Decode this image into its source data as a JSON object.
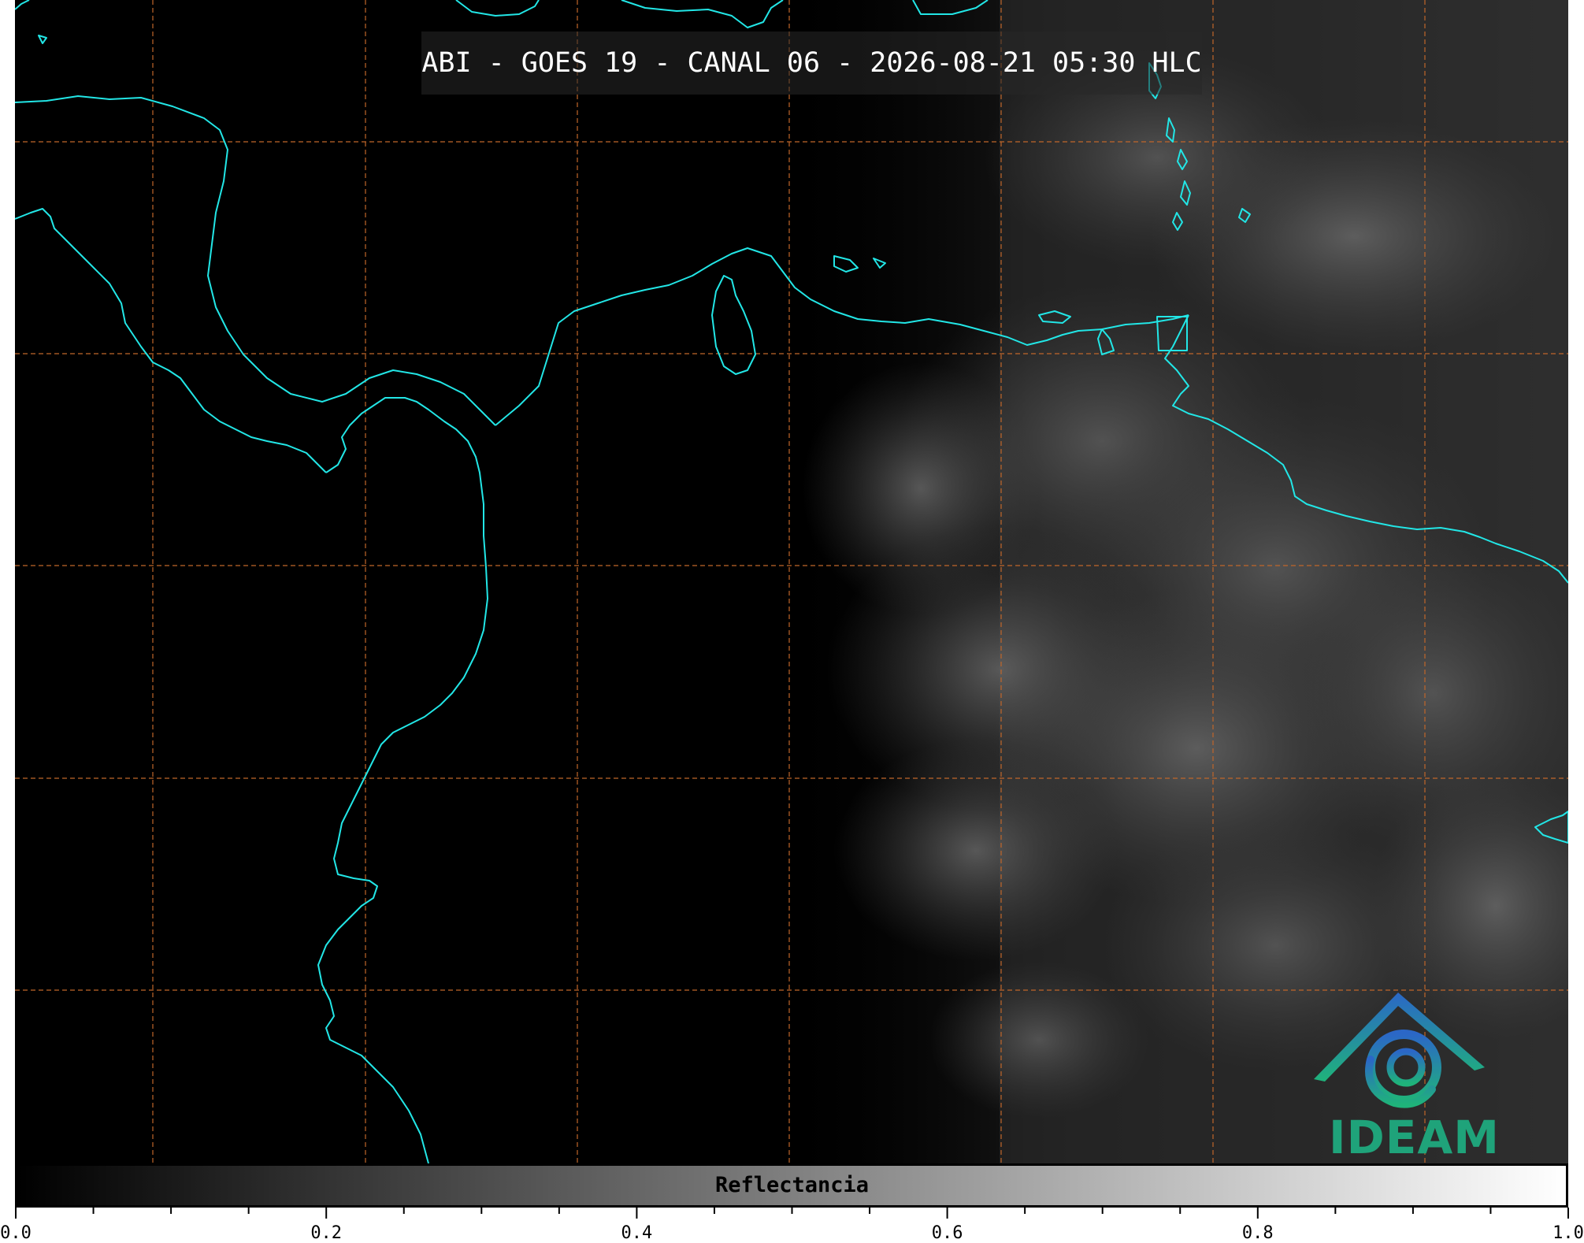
{
  "title": "ABI - GOES 19 - CANAL 06 - 2026-08-21 05:30 HLC",
  "map": {
    "coastline_color": "#22e6e6",
    "gridline_color": "#c0662a",
    "background_color": "#000000"
  },
  "logo": {
    "text": "IDEAM",
    "color": "#1fa37a",
    "icon": "ideam-logo-icon"
  },
  "colorbar": {
    "label": "Reflectancia",
    "range": [
      0.0,
      1.0
    ],
    "colors": [
      "#000000",
      "#ffffff"
    ],
    "tick_labels": [
      "0.0",
      "0.2",
      "0.4",
      "0.6",
      "0.8",
      "1.0"
    ],
    "tick_values": [
      0.0,
      0.2,
      0.4,
      0.6,
      0.8,
      1.0
    ]
  }
}
